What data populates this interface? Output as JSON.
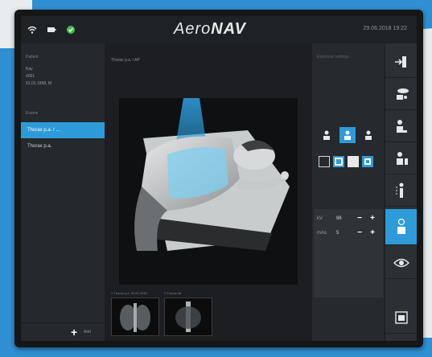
{
  "app": {
    "logo_prefix": "Aero",
    "logo_suffix": "NAV",
    "datetime": "29.06.2018  19:22"
  },
  "left_panel": {
    "patient_label": "Patient",
    "patient_info": [
      "Kay",
      "#001",
      "01.01.1958, M"
    ],
    "exams_label": "Exams",
    "exams": [
      "Thorax p.a. / ...",
      "Thorax p.a."
    ],
    "add_label": "Add"
  },
  "main": {
    "view_label": "Thorax p.a. / AP",
    "thumbnails": [
      {
        "caption": "1 Thorax p.a. 29.06.2018"
      },
      {
        "caption": "2 Thorax lat."
      }
    ]
  },
  "settings": {
    "title": "Exposure settings",
    "params": [
      {
        "name": "kV",
        "value": "96"
      },
      {
        "name": "mAs",
        "value": "5"
      }
    ]
  },
  "colors": {
    "accent": "#2d9bd8",
    "status_ok": "#3fbf4f"
  },
  "icons": {
    "topbar": [
      "wifi-icon",
      "battery-icon",
      "status-ok-icon"
    ],
    "rail": [
      "door-exit-icon",
      "tube-position-icon",
      "patient-seated-icon",
      "patient-position-icon",
      "standing-patient-icon",
      "xray-exposure-icon",
      "eye-icon",
      "image-viewer-icon"
    ]
  }
}
